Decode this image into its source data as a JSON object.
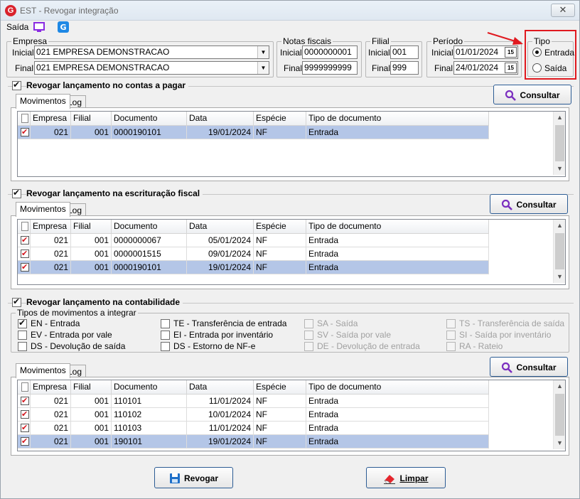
{
  "window": {
    "title": "EST - Revogar integração",
    "close_glyph": "✕"
  },
  "menu": {
    "saida_label": "Saída",
    "icons": [
      "monitor-icon",
      "app-logo-icon"
    ]
  },
  "empresa": {
    "legend": "Empresa",
    "inicial_label": "Inicial",
    "inicial_value": "021 EMPRESA DEMONSTRACAO",
    "final_label": "Final",
    "final_value": "021 EMPRESA DEMONSTRACAO"
  },
  "notas": {
    "legend": "Notas fiscais",
    "inicial_label": "Inicial",
    "inicial_value": "0000000001",
    "final_label": "Final",
    "final_value": "9999999999"
  },
  "filial": {
    "legend": "Filial",
    "inicial_label": "Inicial",
    "inicial_value": "001",
    "final_label": "Final",
    "final_value": "999"
  },
  "periodo": {
    "legend": "Período",
    "inicial_label": "Inicial",
    "inicial_value": "01/01/2024",
    "final_label": "Final",
    "final_value": "24/01/2024",
    "calendar_glyph": "15"
  },
  "tipo": {
    "legend": "Tipo",
    "options": [
      "Entrada",
      "Saída"
    ],
    "selected": "Entrada"
  },
  "colors": {
    "accent": "#2c5c94",
    "selection": "#b4c6e7",
    "highlight": "#e0191f",
    "check": "#d3151c",
    "consultar_icon": "#7b2fbf"
  },
  "columns": [
    "Empresa",
    "Filial",
    "Documento",
    "Data",
    "Espécie",
    "Tipo de documento"
  ],
  "sections": {
    "contas_pagar": {
      "title": "Revogar lançamento no contas a pagar",
      "checked": true,
      "tabs": [
        "Movimentos",
        "Log"
      ],
      "consultar_label": "Consultar",
      "rows": [
        {
          "empresa": "021",
          "filial": "001",
          "documento": "0000190101",
          "data": "19/01/2024",
          "especie": "NF",
          "tipo": "Entrada",
          "selected": true
        }
      ]
    },
    "escrituracao": {
      "title": "Revogar lançamento na escrituração fiscal",
      "checked": true,
      "tabs": [
        "Movimentos",
        "Log"
      ],
      "consultar_label": "Consultar",
      "rows": [
        {
          "empresa": "021",
          "filial": "001",
          "documento": "0000000067",
          "data": "05/01/2024",
          "especie": "NF",
          "tipo": "Entrada",
          "selected": false
        },
        {
          "empresa": "021",
          "filial": "001",
          "documento": "0000001515",
          "data": "09/01/2024",
          "especie": "NF",
          "tipo": "Entrada",
          "selected": false
        },
        {
          "empresa": "021",
          "filial": "001",
          "documento": "0000190101",
          "data": "19/01/2024",
          "especie": "NF",
          "tipo": "Entrada",
          "selected": true
        }
      ]
    },
    "contabilidade": {
      "title": "Revogar lançamento na contabilidade",
      "checked": true,
      "tipos_legend": "Tipos de movimentos a integrar",
      "tipos": [
        {
          "label": "EN - Entrada",
          "checked": true,
          "enabled": true
        },
        {
          "label": "EV - Entrada por vale",
          "checked": false,
          "enabled": true
        },
        {
          "label": "DS - Devolução de saída",
          "checked": false,
          "enabled": true
        },
        {
          "label": "TE - Transferência de entrada",
          "checked": false,
          "enabled": true
        },
        {
          "label": "EI - Entrada por inventário",
          "checked": false,
          "enabled": true
        },
        {
          "label": "DS - Estorno de NF-e",
          "checked": false,
          "enabled": true
        },
        {
          "label": "SA - Saída",
          "checked": false,
          "enabled": false
        },
        {
          "label": "SV - Saída por vale",
          "checked": false,
          "enabled": false
        },
        {
          "label": "DE - Devolução de entrada",
          "checked": false,
          "enabled": false
        },
        {
          "label": "TS - Transferência de saída",
          "checked": false,
          "enabled": false
        },
        {
          "label": "SI - Saída por inventário",
          "checked": false,
          "enabled": false
        },
        {
          "label": "RA - Rateio",
          "checked": false,
          "enabled": false
        }
      ],
      "tabs": [
        "Movimentos",
        "Log"
      ],
      "consultar_label": "Consultar",
      "rows": [
        {
          "empresa": "021",
          "filial": "001",
          "documento": "110101",
          "data": "11/01/2024",
          "especie": "NF",
          "tipo": "Entrada",
          "selected": false
        },
        {
          "empresa": "021",
          "filial": "001",
          "documento": "110102",
          "data": "10/01/2024",
          "especie": "NF",
          "tipo": "Entrada",
          "selected": false
        },
        {
          "empresa": "021",
          "filial": "001",
          "documento": "110103",
          "data": "11/01/2024",
          "especie": "NF",
          "tipo": "Entrada",
          "selected": false
        },
        {
          "empresa": "021",
          "filial": "001",
          "documento": "190101",
          "data": "19/01/2024",
          "especie": "NF",
          "tipo": "Entrada",
          "selected": true
        }
      ]
    }
  },
  "footer": {
    "revogar_label": "Revogar",
    "limpar_label": "Limpar"
  }
}
